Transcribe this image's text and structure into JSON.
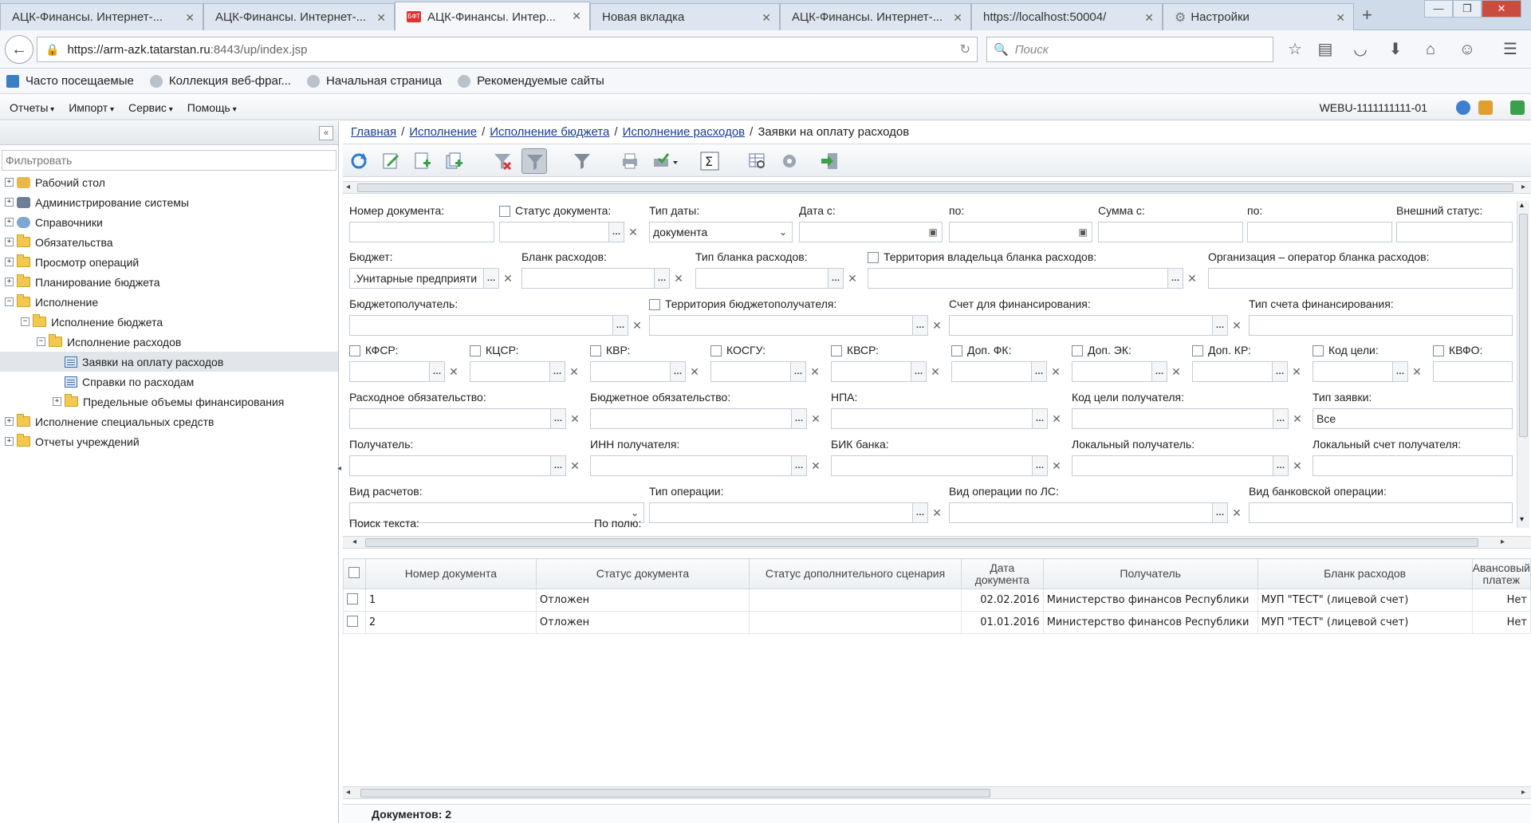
{
  "browser": {
    "tabs": [
      {
        "title": "АЦК-Финансы. Интернет-..."
      },
      {
        "title": "АЦК-Финансы. Интернет-..."
      },
      {
        "title": "АЦК-Финансы. Интер..."
      },
      {
        "title": "Новая вкладка"
      },
      {
        "title": "АЦК-Финансы. Интернет-..."
      },
      {
        "title": "https://localhost:50004/"
      },
      {
        "title": "Настройки"
      }
    ],
    "favicon_text": "БФТ",
    "url_host": "https://arm-azk.tatarstan.ru",
    "url_rest": ":8443/up/index.jsp",
    "search_placeholder": "Поиск",
    "bookmarks": [
      "Часто посещаемые",
      "Коллекция веб-фраг...",
      "Начальная страница",
      "Рекомендуемые сайты"
    ]
  },
  "menu": {
    "items": [
      "Отчеты",
      "Импорт",
      "Сервис",
      "Помощь"
    ],
    "user": "WEBU-1111111111-01"
  },
  "sidebar": {
    "filter_placeholder": "Фильтровать",
    "tree": [
      {
        "label": "Рабочий стол"
      },
      {
        "label": "Администрирование системы"
      },
      {
        "label": "Справочники"
      },
      {
        "label": "Обязательства"
      },
      {
        "label": "Просмотр операций"
      },
      {
        "label": "Планирование бюджета"
      },
      {
        "label": "Исполнение"
      },
      {
        "label": "Исполнение бюджета"
      },
      {
        "label": "Исполнение расходов"
      },
      {
        "label": "Заявки на оплату расходов"
      },
      {
        "label": "Справки по расходам"
      },
      {
        "label": "Предельные объемы финансирования"
      },
      {
        "label": "Исполнение специальных средств"
      },
      {
        "label": "Отчеты учреждений"
      }
    ]
  },
  "breadcrumb": {
    "links": [
      "Главная",
      "Исполнение",
      "Исполнение бюджета",
      "Исполнение расходов"
    ],
    "current": "Заявки на оплату расходов"
  },
  "filters": {
    "row1": {
      "doc_number": "Номер документа:",
      "doc_status": "Статус документа:",
      "date_type": "Тип даты:",
      "date_type_value": "документа",
      "date_from": "Дата с:",
      "date_to": "по:",
      "sum_from": "Сумма с:",
      "sum_to": "по:",
      "ext_status": "Внешний статус:"
    },
    "row2": {
      "budget": "Бюджет:",
      "budget_value": ".Унитарные предприяти",
      "blank": "Бланк расходов:",
      "blank_type": "Тип бланка расходов:",
      "blank_territory": "Территория владельца бланка расходов:",
      "blank_operator": "Организация – оператор бланка расходов:"
    },
    "row3": {
      "recipient": "Бюджетополучатель:",
      "recipient_territory": "Территория бюджетополучателя:",
      "fin_account": "Счет для финансирования:",
      "fin_account_type": "Тип счета финансирования:"
    },
    "row4": [
      "КФСР:",
      "КЦСР:",
      "КВР:",
      "КОСГУ:",
      "КВСР:",
      "Доп. ФК:",
      "Доп. ЭК:",
      "Доп. КР:",
      "Код цели:",
      "КВФО:"
    ],
    "row5": {
      "expense_obligation": "Расходное обязательство:",
      "budget_obligation": "Бюджетное обязательство:",
      "npa": "НПА:",
      "target_code": "Код цели получателя:",
      "request_type": "Тип заявки:",
      "request_type_value": "Все"
    },
    "row6": {
      "payee": "Получатель:",
      "inn": "ИНН получателя:",
      "bik": "БИК банка:",
      "local_payee": "Локальный получатель:",
      "local_account": "Локальный счет получателя:"
    },
    "row7": {
      "settlement": "Вид расчетов:",
      "op_type": "Тип операции:",
      "ls_op": "Вид операции по ЛС:",
      "bank_op": "Вид банковской операции:"
    },
    "row8": {
      "text_search": "Поиск текста:",
      "by_field": "По полю:"
    }
  },
  "grid": {
    "columns": [
      "Номер документа",
      "Статус документа",
      "Статус дополнительного сценария",
      "Дата документа",
      "Получатель",
      "Бланк расходов",
      "Авансовый платеж"
    ],
    "rows": [
      {
        "num": "1",
        "status": "Отложен",
        "extra": "",
        "date": "02.02.2016",
        "payee": "Министерство финансов Республики",
        "blank": "МУП \"ТЕСТ\" (лицевой счет)",
        "advance": "Нет"
      },
      {
        "num": "2",
        "status": "Отложен",
        "extra": "",
        "date": "01.01.2016",
        "payee": "Министерство финансов Республики",
        "blank": "МУП \"ТЕСТ\" (лицевой счет)",
        "advance": "Нет"
      }
    ],
    "footer": "Документов: 2"
  }
}
